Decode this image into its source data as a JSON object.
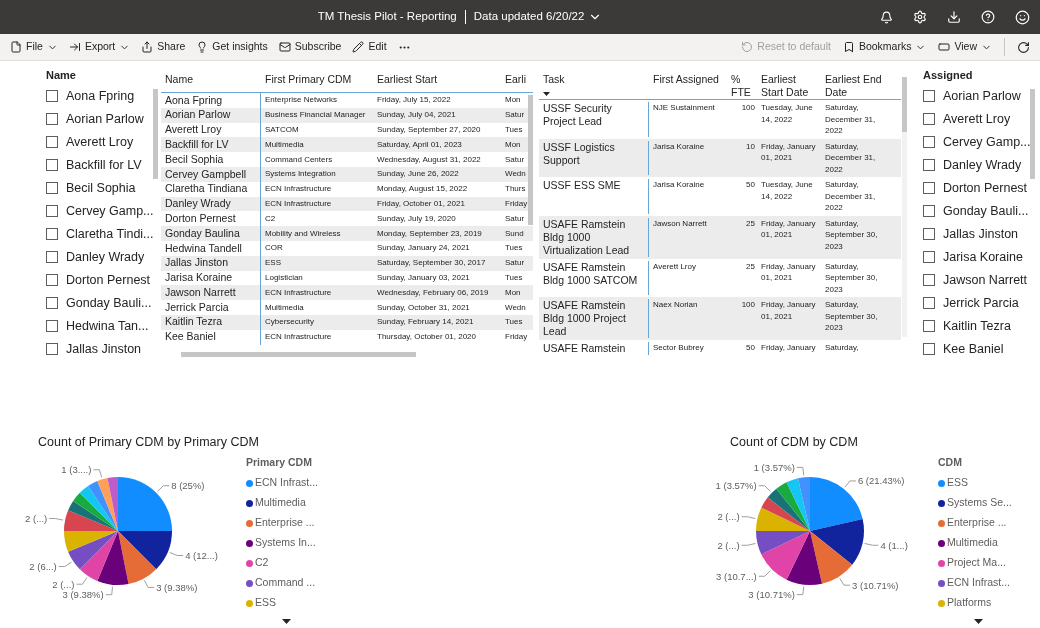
{
  "header": {
    "title": "TM Thesis Pilot - Reporting",
    "data_updated": "Data updated 6/20/22"
  },
  "toolbar": {
    "left": [
      {
        "label": "File",
        "dropdown": true
      },
      {
        "label": "Export",
        "dropdown": true
      },
      {
        "label": "Share",
        "dropdown": false
      },
      {
        "label": "Get insights",
        "dropdown": false
      },
      {
        "label": "Subscribe",
        "dropdown": false
      },
      {
        "label": "Edit",
        "dropdown": false
      }
    ],
    "right": [
      {
        "label": "Reset to default",
        "dropdown": false,
        "disabled": true
      },
      {
        "label": "Bookmarks",
        "dropdown": true,
        "disabled": false
      },
      {
        "label": "View",
        "dropdown": true,
        "disabled": false
      }
    ]
  },
  "name_slicer": {
    "title": "Name",
    "items": [
      {
        "label": "Aona Fpring",
        "checked": false
      },
      {
        "label": "Aorian Parlow",
        "checked": false
      },
      {
        "label": "Averett Lroy",
        "checked": false
      },
      {
        "label": "Backfill for LV",
        "checked": false
      },
      {
        "label": "Becil Sophia",
        "checked": false
      },
      {
        "label": "Cervey Gamp...",
        "checked": false
      },
      {
        "label": "Claretha Tindi...",
        "checked": false
      },
      {
        "label": "Danley Wrady",
        "checked": false
      },
      {
        "label": "Dorton Pernest",
        "checked": false
      },
      {
        "label": "Gonday Bauli...",
        "checked": false
      },
      {
        "label": "Hedwina Tan...",
        "checked": false
      },
      {
        "label": "Jallas Jinston",
        "checked": false
      }
    ]
  },
  "people_table": {
    "columns": [
      "Name",
      "First Primary CDM",
      "Earliest Start",
      "Earli"
    ],
    "rows": [
      [
        "Aona Fpring",
        "Enterprise Networks",
        "Friday, July 15, 2022",
        "Mon"
      ],
      [
        "Aorian Parlow",
        "Business Financial Manager",
        "Sunday, July 04, 2021",
        "Satur"
      ],
      [
        "Averett Lroy",
        "SATCOM",
        "Sunday, September 27, 2020",
        "Tues"
      ],
      [
        "Backfill for LV",
        "Multimedia",
        "Saturday, April 01, 2023",
        "Mon"
      ],
      [
        "Becil Sophia",
        "Command Centers",
        "Wednesday, August 31, 2022",
        "Satur"
      ],
      [
        "Cervey Gampbell",
        "Systems Integration",
        "Sunday, June 26, 2022",
        "Wedn"
      ],
      [
        "Claretha Tindiana",
        "ECN Infrastructure",
        "Monday, August 15, 2022",
        "Thurs"
      ],
      [
        "Danley Wrady",
        "ECN Infrastructure",
        "Friday, October 01, 2021",
        "Friday"
      ],
      [
        "Dorton Pernest",
        "C2",
        "Sunday, July 19, 2020",
        "Satur"
      ],
      [
        "Gonday Baulina",
        "Mobility and Wireless",
        "Monday, September 23, 2019",
        "Sund"
      ],
      [
        "Hedwina Tandell",
        "COR",
        "Sunday, January 24, 2021",
        "Tues"
      ],
      [
        "Jallas Jinston",
        "ESS",
        "Saturday, September 30, 2017",
        "Satur"
      ],
      [
        "Jarisa Koraine",
        "Logistician",
        "Sunday, January 03, 2021",
        "Tues"
      ],
      [
        "Jawson Narrett",
        "ECN Infrastructure",
        "Wednesday, February 06, 2019",
        "Mon"
      ],
      [
        "Jerrick Parcia",
        "Multimedia",
        "Sunday, October 31, 2021",
        "Wedn"
      ],
      [
        "Kaitlin Tezra",
        "Cybersecurity",
        "Sunday, February 14, 2021",
        "Tues"
      ],
      [
        "Kee Baniel",
        "ECN Infrastructure",
        "Thursday, October 01, 2020",
        "Friday"
      ]
    ]
  },
  "task_table": {
    "columns": [
      {
        "label": "Task",
        "sorted": true
      },
      {
        "label": "First Assigned",
        "sorted": false
      },
      {
        "label": "% FTE",
        "sorted": false
      },
      {
        "label": "Earliest Start Date",
        "sorted": false
      },
      {
        "label": "Earliest End Date",
        "sorted": false
      }
    ],
    "rows": [
      [
        "USSF Security Project Lead",
        "NJE Sustainment",
        "100",
        "Tuesday, June 14, 2022",
        "Saturday, December 31, 2022"
      ],
      [
        "USSF Logistics Support",
        "Jarisa Koraine",
        "10",
        "Friday, January 01, 2021",
        "Saturday, December 31, 2022"
      ],
      [
        "USSF ESS SME",
        "Jarisa Koraine",
        "50",
        "Tuesday, June 14, 2022",
        "Saturday, December 31, 2022"
      ],
      [
        "USAFE Ramstein Bldg 1000 Virtualization Lead",
        "Jawson Narrett",
        "25",
        "Friday, January 01, 2021",
        "Saturday, September 30, 2023"
      ],
      [
        "USAFE Ramstein Bldg 1000 SATCOM",
        "Averett Lroy",
        "25",
        "Friday, January 01, 2021",
        "Saturday, September 30, 2023"
      ],
      [
        "USAFE Ramstein Bldg 1000 Project Lead",
        "Naex Norian",
        "100",
        "Friday, January 01, 2021",
        "Saturday, September 30, 2023"
      ],
      [
        "USAFE Ramstein",
        "Sector Bubrey",
        "50",
        "Friday, January",
        "Saturday,"
      ]
    ]
  },
  "assigned_slicer": {
    "title": "Assigned",
    "items": [
      {
        "label": "Aorian Parlow",
        "checked": false
      },
      {
        "label": "Averett Lroy",
        "checked": false
      },
      {
        "label": "Cervey Gamp...",
        "checked": false
      },
      {
        "label": "Danley Wrady",
        "checked": false
      },
      {
        "label": "Dorton Pernest",
        "checked": false
      },
      {
        "label": "Gonday Bauli...",
        "checked": false
      },
      {
        "label": "Jallas Jinston",
        "checked": false
      },
      {
        "label": "Jarisa Koraine",
        "checked": false
      },
      {
        "label": "Jawson Narrett",
        "checked": false
      },
      {
        "label": "Jerrick Parcia",
        "checked": false
      },
      {
        "label": "Kaitlin Tezra",
        "checked": false
      },
      {
        "label": "Kee Baniel",
        "checked": false
      }
    ]
  },
  "charts": [
    {
      "chart_data": {
        "type": "pie",
        "title": "Count of Primary CDM by Primary CDM",
        "values": [
          8,
          4,
          3,
          3,
          2,
          2,
          2,
          2,
          1,
          1,
          1,
          1,
          1,
          1
        ],
        "colors": [
          "#118dff",
          "#12239e",
          "#e66c37",
          "#6b007b",
          "#e044a7",
          "#744ec2",
          "#d9b300",
          "#d64550",
          "#197278",
          "#1aab40",
          "#15c6f4",
          "#4092ff",
          "#ffa058",
          "#be5dc9"
        ],
        "value_labels": [
          "8 (25%)",
          "4 (12...)",
          "3 (9.38%)",
          "3 (9.38%)",
          "2 (...)",
          "2 (6...)",
          null,
          "2 (...)",
          null,
          null,
          null,
          null,
          "1 (3....)",
          null
        ]
      },
      "legend": {
        "title": "Primary CDM",
        "items": [
          {
            "label": "ECN Infrast...",
            "color": "#118dff"
          },
          {
            "label": "Multimedia",
            "color": "#12239e"
          },
          {
            "label": "Enterprise ...",
            "color": "#e66c37"
          },
          {
            "label": "Systems In...",
            "color": "#6b007b"
          },
          {
            "label": "C2",
            "color": "#e044a7"
          },
          {
            "label": "Command ...",
            "color": "#744ec2"
          },
          {
            "label": "ESS",
            "color": "#d9b300"
          }
        ]
      }
    },
    {
      "chart_data": {
        "type": "pie",
        "title": "Count of CDM by CDM",
        "values": [
          6,
          4,
          3,
          3,
          3,
          2,
          2,
          1,
          1,
          1,
          1,
          1
        ],
        "colors": [
          "#118dff",
          "#12239e",
          "#e66c37",
          "#6b007b",
          "#e044a7",
          "#744ec2",
          "#d9b300",
          "#d64550",
          "#197278",
          "#1aab40",
          "#15c6f4",
          "#4092ff"
        ],
        "value_labels": [
          "6 (21.43%)",
          "4 (1...)",
          "3 (10.71%)",
          "3 (10.71%)",
          "3 (10.7...)",
          "2 (...)",
          "2 (...)",
          null,
          "1 (3.57%)",
          null,
          null,
          "1 (3.57%)"
        ]
      },
      "legend": {
        "title": "CDM",
        "items": [
          {
            "label": "ESS",
            "color": "#118dff"
          },
          {
            "label": "Systems Se...",
            "color": "#12239e"
          },
          {
            "label": "Enterprise ...",
            "color": "#e66c37"
          },
          {
            "label": "Multimedia",
            "color": "#6b007b"
          },
          {
            "label": "Project Ma...",
            "color": "#e044a7"
          },
          {
            "label": "ECN Infrast...",
            "color": "#744ec2"
          },
          {
            "label": "Platforms",
            "color": "#d9b300"
          }
        ]
      }
    }
  ]
}
